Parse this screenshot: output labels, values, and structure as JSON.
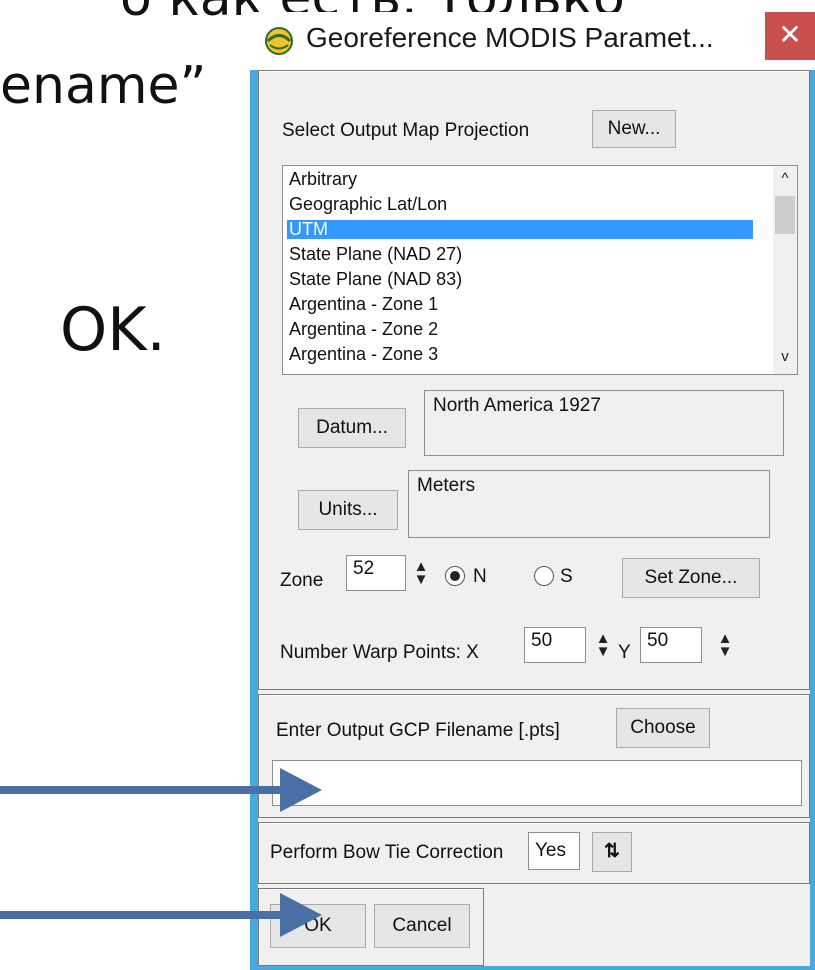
{
  "slide": {
    "line1": "о как есть. Только",
    "line2": "ename”",
    "line3": "OK."
  },
  "dialog": {
    "title": "Georeference MODIS Paramet...",
    "close_label": "✕",
    "projection": {
      "label": "Select Output Map Projection",
      "new_button": "New...",
      "items": [
        "Arbitrary",
        "Geographic Lat/Lon",
        "UTM",
        "State Plane (NAD 27)",
        "State Plane (NAD 83)",
        "Argentina - Zone 1",
        "Argentina - Zone 2",
        "Argentina - Zone 3"
      ],
      "selected_index": 2
    },
    "datum": {
      "button": "Datum...",
      "value": "North America 1927"
    },
    "units": {
      "button": "Units...",
      "value": "Meters"
    },
    "zone": {
      "label": "Zone",
      "value": "52",
      "north_label": "N",
      "south_label": "S",
      "selected": "N",
      "set_zone_button": "Set Zone..."
    },
    "warp": {
      "label": "Number Warp Points: X",
      "x_value": "50",
      "y_label": "Y",
      "y_value": "50"
    },
    "gcp": {
      "label": "Enter Output GCP Filename [.pts]",
      "choose_button": "Choose",
      "filename_value": ""
    },
    "bowtie": {
      "label": "Perform Bow Tie Correction",
      "value": "Yes",
      "toggle_icon": "sort-arrows-icon"
    },
    "actions": {
      "ok": "OK",
      "cancel": "Cancel"
    }
  },
  "colors": {
    "title_bar_border": "#4aa8df",
    "close_button": "#c9504c",
    "selection": "#3399ff",
    "arrow": "#4a6fa5"
  }
}
